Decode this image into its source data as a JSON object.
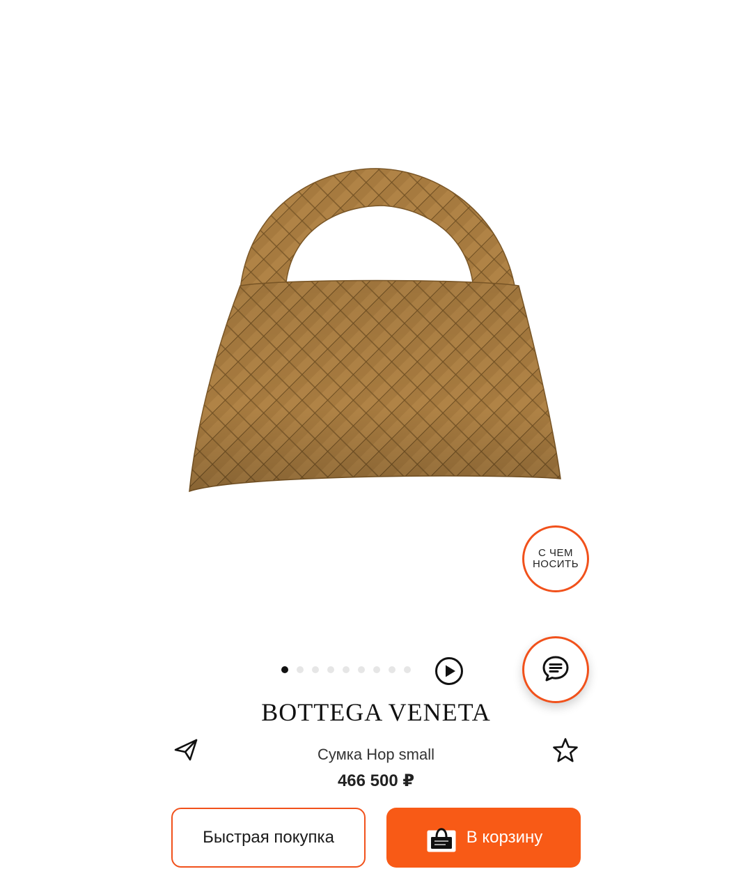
{
  "product": {
    "brand": "BOTTEGA VENETA",
    "name": "Сумка Hop small",
    "price": "466 500 ₽",
    "image_icon": "woven-hobo-bag-image"
  },
  "gallery": {
    "total_images": 9,
    "active_index": 0,
    "play_icon": "play-circle-icon"
  },
  "floating": {
    "outfit_label": "С ЧЕМ\nНОСИТЬ",
    "chat_icon": "chat-bubble-icon"
  },
  "actions": {
    "share_icon": "paper-plane-icon",
    "favorite_icon": "star-outline-icon",
    "quick_buy_label": "Быстрая покупка",
    "add_to_cart_label": "В корзину",
    "cart_icon": "shopping-bag-icon"
  },
  "colors": {
    "accent": "#f85a16",
    "accent_border": "#f1511b",
    "bag": "#a67a3f"
  }
}
